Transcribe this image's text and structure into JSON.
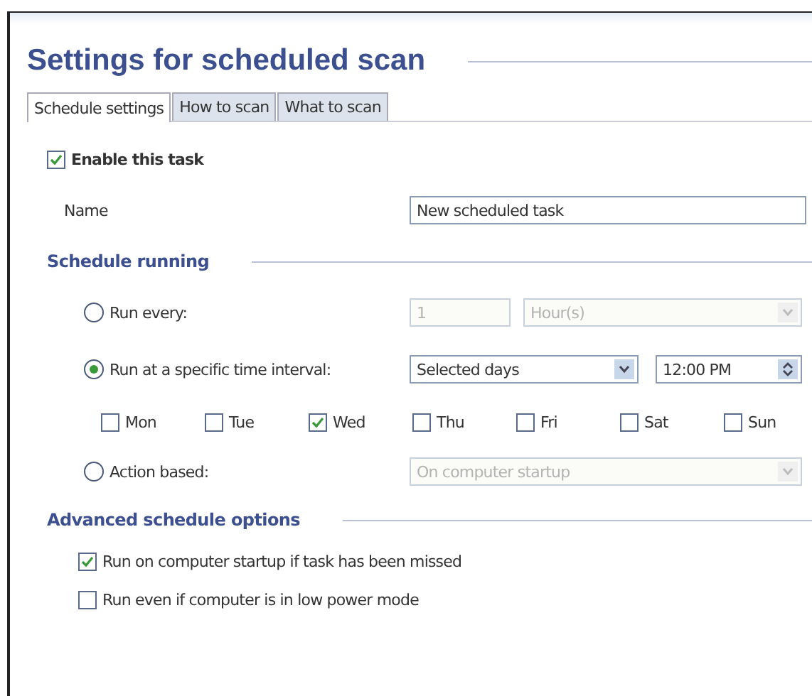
{
  "title": "Settings for scheduled scan",
  "tabs": [
    {
      "label": "Schedule settings",
      "selected": true
    },
    {
      "label": "How to scan",
      "selected": false
    },
    {
      "label": "What to scan",
      "selected": false
    }
  ],
  "enable_task": {
    "label": "Enable this task",
    "checked": true
  },
  "name": {
    "label": "Name",
    "value": "New scheduled task"
  },
  "schedule_running": {
    "heading": "Schedule running",
    "run_every": {
      "label": "Run every:",
      "selected": false,
      "count": "1",
      "unit": "Hour(s)",
      "disabled": true
    },
    "specific_time": {
      "label": "Run at a specific time interval:",
      "selected": true,
      "days_mode": "Selected days",
      "time": "12:00 PM"
    },
    "days": [
      {
        "label": "Mon",
        "checked": false
      },
      {
        "label": "Tue",
        "checked": false
      },
      {
        "label": "Wed",
        "checked": true
      },
      {
        "label": "Thu",
        "checked": false
      },
      {
        "label": "Fri",
        "checked": false
      },
      {
        "label": "Sat",
        "checked": false
      },
      {
        "label": "Sun",
        "checked": false
      }
    ],
    "action_based": {
      "label": "Action based:",
      "selected": false,
      "action": "On computer startup",
      "disabled": true
    }
  },
  "advanced": {
    "heading": "Advanced schedule options",
    "options": [
      {
        "label": "Run on computer startup if task has been missed",
        "checked": true
      },
      {
        "label": "Run even if computer is in low power mode",
        "checked": false
      }
    ]
  }
}
